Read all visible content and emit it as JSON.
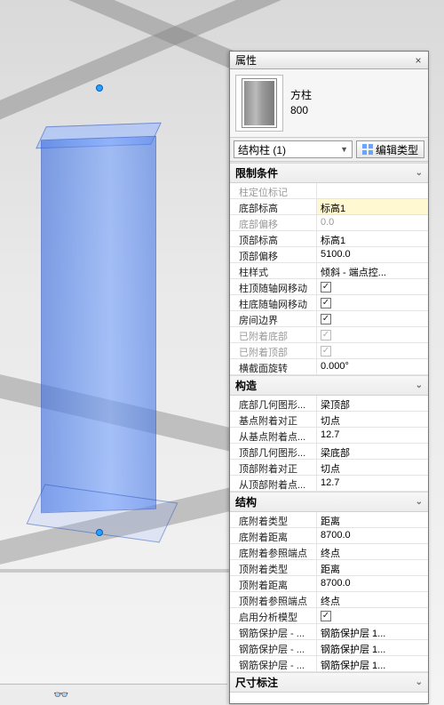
{
  "panel": {
    "title": "属性",
    "type_family": "方柱",
    "type_name": "800",
    "filter": "结构柱 (1)",
    "edit_type": "编辑类型"
  },
  "groups": [
    {
      "name": "限制条件",
      "rows": [
        {
          "label": "柱定位标记",
          "value": "",
          "ro": true
        },
        {
          "label": "底部标高",
          "value": "标高1",
          "hi": true
        },
        {
          "label": "底部偏移",
          "value": "0.0",
          "ro": true
        },
        {
          "label": "顶部标高",
          "value": "标高1"
        },
        {
          "label": "顶部偏移",
          "value": "5100.0"
        },
        {
          "label": "柱样式",
          "value": "倾斜 - 端点控..."
        },
        {
          "label": "柱顶随轴网移动",
          "check": true
        },
        {
          "label": "柱底随轴网移动",
          "check": true
        },
        {
          "label": "房间边界",
          "check": true
        },
        {
          "label": "已附着底部",
          "check": true,
          "ro": true
        },
        {
          "label": "已附着顶部",
          "check": true,
          "ro": true
        },
        {
          "label": "横截面旋转",
          "value": "0.000°"
        }
      ]
    },
    {
      "name": "构造",
      "rows": [
        {
          "label": "底部几何图形...",
          "value": "梁顶部"
        },
        {
          "label": "基点附着对正",
          "value": "切点"
        },
        {
          "label": "从基点附着点...",
          "value": "12.7"
        },
        {
          "label": "顶部几何图形...",
          "value": "梁底部"
        },
        {
          "label": "顶部附着对正",
          "value": "切点"
        },
        {
          "label": "从顶部附着点...",
          "value": "12.7"
        }
      ]
    },
    {
      "name": "结构",
      "rows": [
        {
          "label": "底附着类型",
          "value": "距离"
        },
        {
          "label": "底附着距离",
          "value": "8700.0"
        },
        {
          "label": "底附着参照端点",
          "value": "终点"
        },
        {
          "label": "顶附着类型",
          "value": "距离"
        },
        {
          "label": "顶附着距离",
          "value": "8700.0"
        },
        {
          "label": "顶附着参照端点",
          "value": "终点"
        },
        {
          "label": "启用分析模型",
          "check": true
        },
        {
          "label": "钢筋保护层 - ...",
          "value": "钢筋保护层 1..."
        },
        {
          "label": "钢筋保护层 - ...",
          "value": "钢筋保护层 1..."
        },
        {
          "label": "钢筋保护层 - ...",
          "value": "钢筋保护层 1..."
        }
      ]
    },
    {
      "name": "尺寸标注",
      "rows": []
    }
  ]
}
